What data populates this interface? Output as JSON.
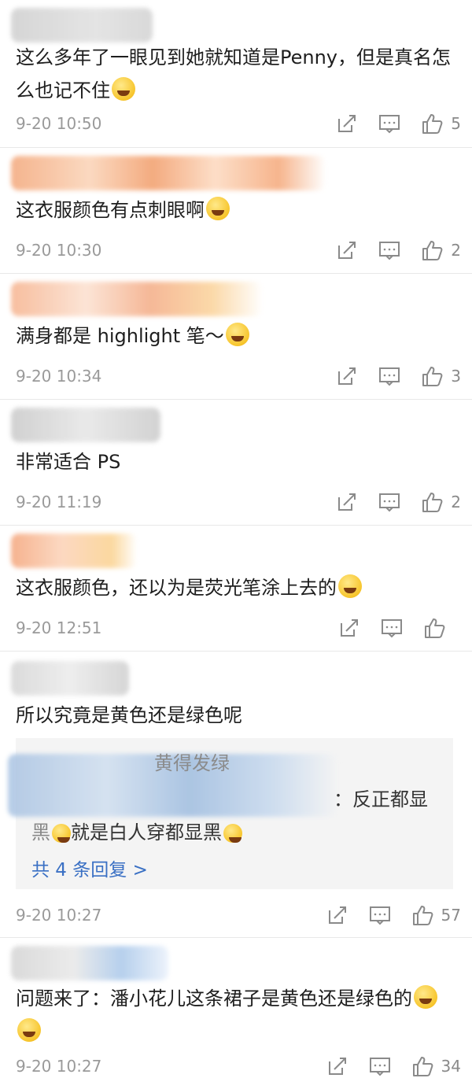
{
  "comments": [
    {
      "text": "这么多年了一眼见到她就知道是Penny，但是真名怎么也记不住",
      "time": "9-20 10:50",
      "likes": "5"
    },
    {
      "text": "这衣服颜色有点刺眼啊",
      "time": "9-20 10:30",
      "likes": "2"
    },
    {
      "text": "满身都是 highlight 笔～",
      "time": "9-20 10:34",
      "likes": "3"
    },
    {
      "text": "非常适合 PS",
      "time": "9-20 11:19",
      "likes": "2"
    },
    {
      "text": "这衣服颜色，还以为是荧光笔涂上去的",
      "time": "9-20 12:51",
      "likes": ""
    },
    {
      "text": "所以究竟是黄色还是绿色呢",
      "time": "9-20 10:27",
      "likes": "57",
      "replies": {
        "line1": "黄得发绿",
        "line2": "：反正都显",
        "line3": "黑",
        "line3b": "就是白人穿都显黑",
        "more": "共 4 条回复 >"
      }
    },
    {
      "text": "问题来了：潘小花儿这条裙子是黄色还是绿色的",
      "time": "9-20 10:27",
      "likes": "34"
    }
  ],
  "icons": {
    "share": "share-icon",
    "reply": "comment-icon",
    "like": "thumbs-up-icon"
  },
  "colors": {
    "link": "#3a70c4",
    "meta": "#9a9a9a",
    "divider": "#e8e8e8"
  }
}
